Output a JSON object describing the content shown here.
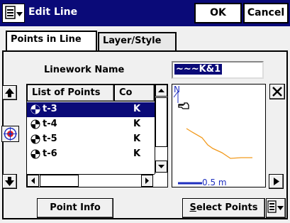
{
  "titlebar": {
    "title": "Edit Line",
    "ok_label": "OK",
    "cancel_label": "Cancel",
    "menu_icon": "menu-icon"
  },
  "tabs": [
    {
      "label": "Points in Line",
      "active": true
    },
    {
      "label": "Layer/Style",
      "active": false
    }
  ],
  "linework": {
    "label": "Linework Name",
    "value": "~~~K&1"
  },
  "list": {
    "headers": [
      "List of Points",
      "Code"
    ],
    "header_code_visible": "Co",
    "rows": [
      {
        "name": "t-3",
        "code": "K",
        "selected": true
      },
      {
        "name": "t-4",
        "code": "K",
        "selected": false
      },
      {
        "name": "t-5",
        "code": "K",
        "selected": false
      },
      {
        "name": "t-6",
        "code": "K",
        "selected": false
      }
    ]
  },
  "map": {
    "north": "N",
    "scale_label": "0.5 m"
  },
  "buttons": {
    "point_info": "Point Info",
    "select_points": "Select Points"
  },
  "colors": {
    "title_bg": "#0a0a78",
    "selection": "#0a0a78",
    "line": "#f29a1d",
    "north": "#1f2fbf"
  }
}
